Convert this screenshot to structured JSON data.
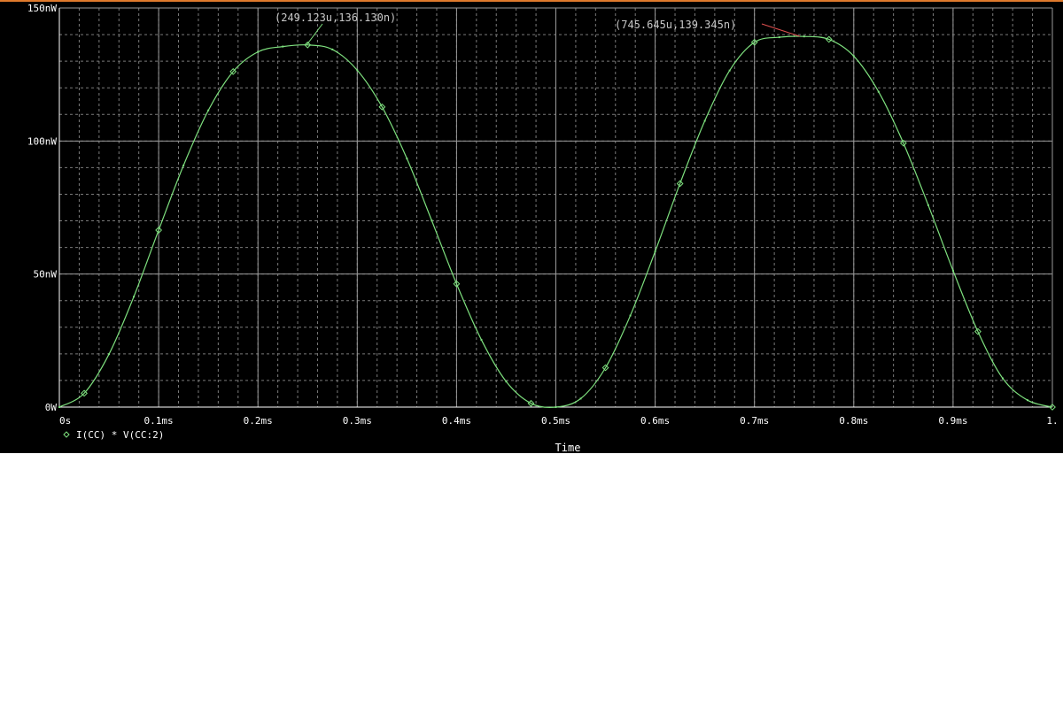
{
  "window": {
    "background": "#000000",
    "accent": "#e07a2c"
  },
  "chart_data": {
    "type": "line",
    "xlabel": "Time",
    "ylabel": "",
    "xlim": [
      0,
      1.0
    ],
    "ylim": [
      0,
      150
    ],
    "x_unit_note": "ms",
    "y_unit_note": "nW",
    "x_ticks": [
      0,
      0.1,
      0.2,
      0.3,
      0.4,
      0.5,
      0.6,
      0.7,
      0.8,
      0.9,
      1.0
    ],
    "x_tick_labels": [
      "0s",
      "0.1ms",
      "0.2ms",
      "0.3ms",
      "0.4ms",
      "0.5ms",
      "0.6ms",
      "0.7ms",
      "0.8ms",
      "0.9ms",
      "1."
    ],
    "y_ticks": [
      0,
      50,
      100,
      150
    ],
    "y_tick_labels": [
      "0W",
      "50nW",
      "100nW",
      "150nW"
    ],
    "grid": true,
    "legend_position": "bottom-left",
    "series": [
      {
        "name": "I(CC) * V(CC:2)",
        "color": "#7ee07e",
        "marker": "diamond",
        "x": [
          0,
          0.025,
          0.05,
          0.075,
          0.1,
          0.125,
          0.15,
          0.175,
          0.2,
          0.225,
          0.25,
          0.275,
          0.3,
          0.325,
          0.35,
          0.375,
          0.4,
          0.425,
          0.45,
          0.475,
          0.5,
          0.525,
          0.55,
          0.575,
          0.6,
          0.625,
          0.65,
          0.675,
          0.7,
          0.725,
          0.75,
          0.775,
          0.8,
          0.825,
          0.85,
          0.875,
          0.9,
          0.925,
          0.95,
          0.975,
          1.0
        ],
        "y": [
          0,
          5.2,
          19.9,
          41.5,
          66.5,
          90.8,
          111.5,
          126.1,
          133.5,
          135.5,
          136.1,
          134.4,
          126.6,
          112.8,
          93.4,
          70.1,
          46.3,
          25.3,
          9.6,
          1.4,
          0,
          3.2,
          14.8,
          34.4,
          58.5,
          84.0,
          107.6,
          126.5,
          137.1,
          139.0,
          139.3,
          138.2,
          131.9,
          118.5,
          99.2,
          75.9,
          51.3,
          28.4,
          10.8,
          2.6,
          0
        ]
      }
    ],
    "annotations": [
      {
        "text": "(249.123u,136.130n)",
        "x": 0.249123,
        "y": 136.13,
        "color": "#7ee07e"
      },
      {
        "text": "(745.645u,139.345n)",
        "x": 0.745645,
        "y": 139.345,
        "color": "#e05050"
      }
    ]
  }
}
